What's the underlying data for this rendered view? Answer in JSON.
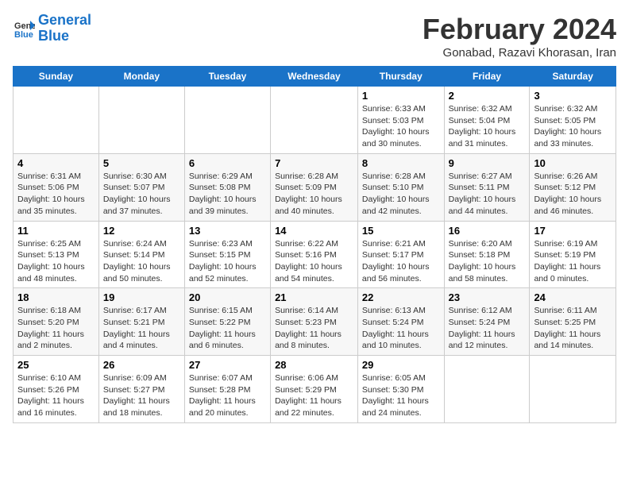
{
  "header": {
    "logo_line1": "General",
    "logo_line2": "Blue",
    "month_title": "February 2024",
    "subtitle": "Gonabad, Razavi Khorasan, Iran"
  },
  "days_of_week": [
    "Sunday",
    "Monday",
    "Tuesday",
    "Wednesday",
    "Thursday",
    "Friday",
    "Saturday"
  ],
  "weeks": [
    [
      {
        "num": "",
        "info": ""
      },
      {
        "num": "",
        "info": ""
      },
      {
        "num": "",
        "info": ""
      },
      {
        "num": "",
        "info": ""
      },
      {
        "num": "1",
        "info": "Sunrise: 6:33 AM\nSunset: 5:03 PM\nDaylight: 10 hours\nand 30 minutes."
      },
      {
        "num": "2",
        "info": "Sunrise: 6:32 AM\nSunset: 5:04 PM\nDaylight: 10 hours\nand 31 minutes."
      },
      {
        "num": "3",
        "info": "Sunrise: 6:32 AM\nSunset: 5:05 PM\nDaylight: 10 hours\nand 33 minutes."
      }
    ],
    [
      {
        "num": "4",
        "info": "Sunrise: 6:31 AM\nSunset: 5:06 PM\nDaylight: 10 hours\nand 35 minutes."
      },
      {
        "num": "5",
        "info": "Sunrise: 6:30 AM\nSunset: 5:07 PM\nDaylight: 10 hours\nand 37 minutes."
      },
      {
        "num": "6",
        "info": "Sunrise: 6:29 AM\nSunset: 5:08 PM\nDaylight: 10 hours\nand 39 minutes."
      },
      {
        "num": "7",
        "info": "Sunrise: 6:28 AM\nSunset: 5:09 PM\nDaylight: 10 hours\nand 40 minutes."
      },
      {
        "num": "8",
        "info": "Sunrise: 6:28 AM\nSunset: 5:10 PM\nDaylight: 10 hours\nand 42 minutes."
      },
      {
        "num": "9",
        "info": "Sunrise: 6:27 AM\nSunset: 5:11 PM\nDaylight: 10 hours\nand 44 minutes."
      },
      {
        "num": "10",
        "info": "Sunrise: 6:26 AM\nSunset: 5:12 PM\nDaylight: 10 hours\nand 46 minutes."
      }
    ],
    [
      {
        "num": "11",
        "info": "Sunrise: 6:25 AM\nSunset: 5:13 PM\nDaylight: 10 hours\nand 48 minutes."
      },
      {
        "num": "12",
        "info": "Sunrise: 6:24 AM\nSunset: 5:14 PM\nDaylight: 10 hours\nand 50 minutes."
      },
      {
        "num": "13",
        "info": "Sunrise: 6:23 AM\nSunset: 5:15 PM\nDaylight: 10 hours\nand 52 minutes."
      },
      {
        "num": "14",
        "info": "Sunrise: 6:22 AM\nSunset: 5:16 PM\nDaylight: 10 hours\nand 54 minutes."
      },
      {
        "num": "15",
        "info": "Sunrise: 6:21 AM\nSunset: 5:17 PM\nDaylight: 10 hours\nand 56 minutes."
      },
      {
        "num": "16",
        "info": "Sunrise: 6:20 AM\nSunset: 5:18 PM\nDaylight: 10 hours\nand 58 minutes."
      },
      {
        "num": "17",
        "info": "Sunrise: 6:19 AM\nSunset: 5:19 PM\nDaylight: 11 hours\nand 0 minutes."
      }
    ],
    [
      {
        "num": "18",
        "info": "Sunrise: 6:18 AM\nSunset: 5:20 PM\nDaylight: 11 hours\nand 2 minutes."
      },
      {
        "num": "19",
        "info": "Sunrise: 6:17 AM\nSunset: 5:21 PM\nDaylight: 11 hours\nand 4 minutes."
      },
      {
        "num": "20",
        "info": "Sunrise: 6:15 AM\nSunset: 5:22 PM\nDaylight: 11 hours\nand 6 minutes."
      },
      {
        "num": "21",
        "info": "Sunrise: 6:14 AM\nSunset: 5:23 PM\nDaylight: 11 hours\nand 8 minutes."
      },
      {
        "num": "22",
        "info": "Sunrise: 6:13 AM\nSunset: 5:24 PM\nDaylight: 11 hours\nand 10 minutes."
      },
      {
        "num": "23",
        "info": "Sunrise: 6:12 AM\nSunset: 5:24 PM\nDaylight: 11 hours\nand 12 minutes."
      },
      {
        "num": "24",
        "info": "Sunrise: 6:11 AM\nSunset: 5:25 PM\nDaylight: 11 hours\nand 14 minutes."
      }
    ],
    [
      {
        "num": "25",
        "info": "Sunrise: 6:10 AM\nSunset: 5:26 PM\nDaylight: 11 hours\nand 16 minutes."
      },
      {
        "num": "26",
        "info": "Sunrise: 6:09 AM\nSunset: 5:27 PM\nDaylight: 11 hours\nand 18 minutes."
      },
      {
        "num": "27",
        "info": "Sunrise: 6:07 AM\nSunset: 5:28 PM\nDaylight: 11 hours\nand 20 minutes."
      },
      {
        "num": "28",
        "info": "Sunrise: 6:06 AM\nSunset: 5:29 PM\nDaylight: 11 hours\nand 22 minutes."
      },
      {
        "num": "29",
        "info": "Sunrise: 6:05 AM\nSunset: 5:30 PM\nDaylight: 11 hours\nand 24 minutes."
      },
      {
        "num": "",
        "info": ""
      },
      {
        "num": "",
        "info": ""
      }
    ]
  ]
}
